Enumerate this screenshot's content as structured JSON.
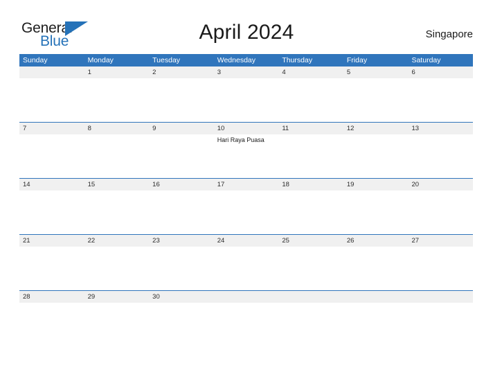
{
  "brand": {
    "name_part1": "General",
    "name_part2": "Blue",
    "triangle_icon": "triangle-icon",
    "accent_color": "#2572b8"
  },
  "header": {
    "title": "April 2024",
    "locale": "Singapore"
  },
  "colors": {
    "header_blue": "#3075bc",
    "row_line_blue": "#2f74bb",
    "day_band_gray": "#f0f0f0",
    "text_dark": "#1a1a1a",
    "white": "#ffffff"
  },
  "calendar": {
    "month": "April",
    "year": "2024",
    "weekdays": [
      "Sunday",
      "Monday",
      "Tuesday",
      "Wednesday",
      "Thursday",
      "Friday",
      "Saturday"
    ],
    "weeks": [
      {
        "days": [
          {
            "num": "",
            "event": ""
          },
          {
            "num": "1",
            "event": ""
          },
          {
            "num": "2",
            "event": ""
          },
          {
            "num": "3",
            "event": ""
          },
          {
            "num": "4",
            "event": ""
          },
          {
            "num": "5",
            "event": ""
          },
          {
            "num": "6",
            "event": ""
          }
        ]
      },
      {
        "days": [
          {
            "num": "7",
            "event": ""
          },
          {
            "num": "8",
            "event": ""
          },
          {
            "num": "9",
            "event": ""
          },
          {
            "num": "10",
            "event": "Hari Raya Puasa"
          },
          {
            "num": "11",
            "event": ""
          },
          {
            "num": "12",
            "event": ""
          },
          {
            "num": "13",
            "event": ""
          }
        ]
      },
      {
        "days": [
          {
            "num": "14",
            "event": ""
          },
          {
            "num": "15",
            "event": ""
          },
          {
            "num": "16",
            "event": ""
          },
          {
            "num": "17",
            "event": ""
          },
          {
            "num": "18",
            "event": ""
          },
          {
            "num": "19",
            "event": ""
          },
          {
            "num": "20",
            "event": ""
          }
        ]
      },
      {
        "days": [
          {
            "num": "21",
            "event": ""
          },
          {
            "num": "22",
            "event": ""
          },
          {
            "num": "23",
            "event": ""
          },
          {
            "num": "24",
            "event": ""
          },
          {
            "num": "25",
            "event": ""
          },
          {
            "num": "26",
            "event": ""
          },
          {
            "num": "27",
            "event": ""
          }
        ]
      },
      {
        "days": [
          {
            "num": "28",
            "event": ""
          },
          {
            "num": "29",
            "event": ""
          },
          {
            "num": "30",
            "event": ""
          },
          {
            "num": "",
            "event": ""
          },
          {
            "num": "",
            "event": ""
          },
          {
            "num": "",
            "event": ""
          },
          {
            "num": "",
            "event": ""
          }
        ]
      }
    ]
  }
}
